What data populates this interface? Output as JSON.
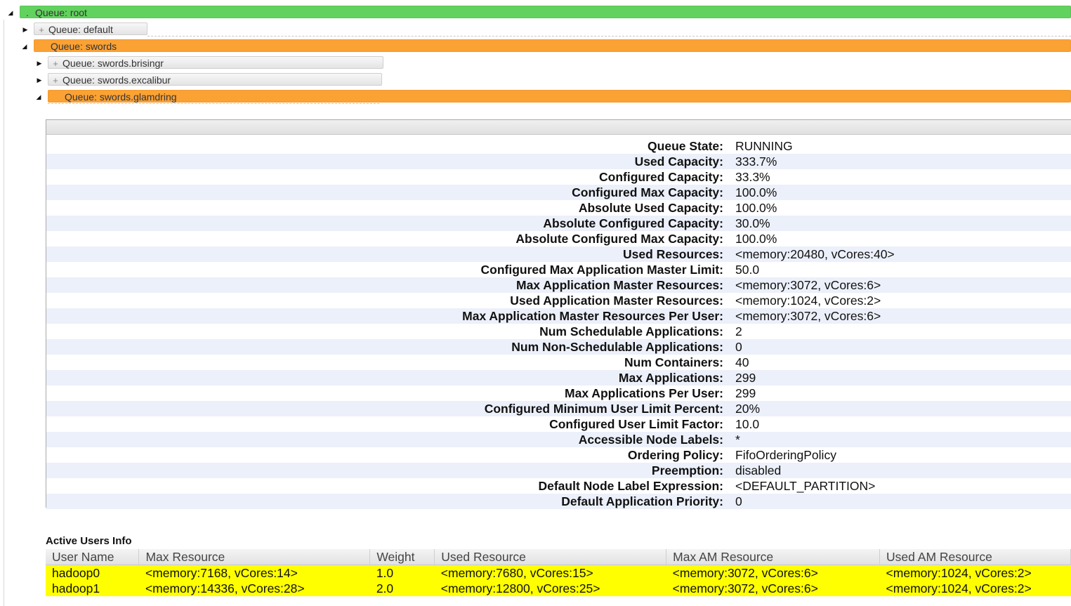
{
  "queues": [
    {
      "label": "Queue: root",
      "prefix": ".",
      "state": "expanded",
      "color": "#62d25e"
    },
    {
      "label": "Queue: default",
      "prefix": "+",
      "state": "collapsed"
    },
    {
      "label": "Queue: swords",
      "prefix": "",
      "state": "expanded",
      "color": "#fba234"
    },
    {
      "label": "Queue: swords.brisingr",
      "prefix": "+",
      "state": "collapsed"
    },
    {
      "label": "Queue: swords.excalibur",
      "prefix": "+",
      "state": "collapsed"
    },
    {
      "label": "Queue: swords.glamdring",
      "prefix": "",
      "state": "expanded",
      "color": "#fba234"
    }
  ],
  "queue_info": [
    {
      "label": "Queue State:",
      "value": "RUNNING"
    },
    {
      "label": "Used Capacity:",
      "value": "333.7%"
    },
    {
      "label": "Configured Capacity:",
      "value": "33.3%"
    },
    {
      "label": "Configured Max Capacity:",
      "value": "100.0%"
    },
    {
      "label": "Absolute Used Capacity:",
      "value": "100.0%"
    },
    {
      "label": "Absolute Configured Capacity:",
      "value": "30.0%"
    },
    {
      "label": "Absolute Configured Max Capacity:",
      "value": "100.0%"
    },
    {
      "label": "Used Resources:",
      "value": "<memory:20480, vCores:40>"
    },
    {
      "label": "Configured Max Application Master Limit:",
      "value": "50.0"
    },
    {
      "label": "Max Application Master Resources:",
      "value": "<memory:3072, vCores:6>"
    },
    {
      "label": "Used Application Master Resources:",
      "value": "<memory:1024, vCores:2>"
    },
    {
      "label": "Max Application Master Resources Per User:",
      "value": "<memory:3072, vCores:6>"
    },
    {
      "label": "Num Schedulable Applications:",
      "value": "2"
    },
    {
      "label": "Num Non-Schedulable Applications:",
      "value": "0"
    },
    {
      "label": "Num Containers:",
      "value": "40"
    },
    {
      "label": "Max Applications:",
      "value": "299"
    },
    {
      "label": "Max Applications Per User:",
      "value": "299"
    },
    {
      "label": "Configured Minimum User Limit Percent:",
      "value": "20%"
    },
    {
      "label": "Configured User Limit Factor:",
      "value": "10.0"
    },
    {
      "label": "Accessible Node Labels:",
      "value": "*"
    },
    {
      "label": "Ordering Policy:",
      "value": "FifoOrderingPolicy"
    },
    {
      "label": "Preemption:",
      "value": "disabled"
    },
    {
      "label": "Default Node Label Expression:",
      "value": "<DEFAULT_PARTITION>"
    },
    {
      "label": "Default Application Priority:",
      "value": "0"
    }
  ],
  "active_users": {
    "title": "Active Users Info",
    "columns": [
      "User Name",
      "Max Resource",
      "Weight",
      "Used Resource",
      "Max AM Resource",
      "Used AM Resource"
    ],
    "rows": [
      [
        "hadoop0",
        "<memory:7168, vCores:14>",
        "1.0",
        "<memory:7680, vCores:15>",
        "<memory:3072, vCores:6>",
        "<memory:1024, vCores:2>"
      ],
      [
        "hadoop1",
        "<memory:14336, vCores:28>",
        "2.0",
        "<memory:12800, vCores:25>",
        "<memory:3072, vCores:6>",
        "<memory:1024, vCores:2>"
      ]
    ],
    "highlight_color": "#ffff00"
  }
}
